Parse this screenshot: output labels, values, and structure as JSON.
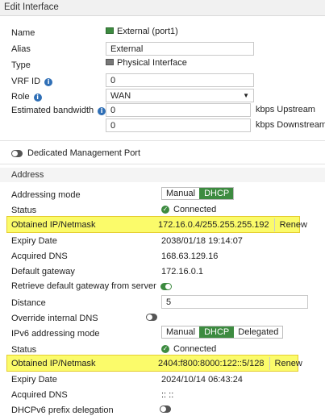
{
  "header": {
    "title": "Edit Interface"
  },
  "fields": {
    "name_label": "Name",
    "name_value": "External (port1)",
    "alias_label": "Alias",
    "alias_value": "External",
    "type_label": "Type",
    "type_value": "Physical Interface",
    "vrf_label": "VRF ID",
    "vrf_value": "0",
    "role_label": "Role",
    "role_value": "WAN",
    "bw_label": "Estimated bandwidth",
    "bw_up_value": "0",
    "bw_up_unit": "kbps Upstream",
    "bw_down_value": "0",
    "bw_down_unit": "kbps Downstream",
    "dedicated_mgmt_label": "Dedicated Management Port"
  },
  "address": {
    "section_title": "Address",
    "addressing_mode_label": "Addressing mode",
    "addressing_mode_options": [
      "Manual",
      "DHCP"
    ],
    "addressing_mode_selected": "DHCP",
    "status_label": "Status",
    "status_value": "Connected",
    "obtained_label": "Obtained IP/Netmask",
    "obtained_value": "172.16.0.4/255.255.255.192",
    "renew_label": "Renew",
    "expiry_label": "Expiry Date",
    "expiry_value": "2038/01/18 19:14:07",
    "dns_label": "Acquired DNS",
    "dns_value": "168.63.129.16",
    "gateway_label": "Default gateway",
    "gateway_value": "172.16.0.1",
    "retrieve_gw_label": "Retrieve default gateway from server",
    "retrieve_gw_enabled": true,
    "distance_label": "Distance",
    "distance_value": "5",
    "override_dns_label": "Override internal DNS",
    "override_dns_enabled": false
  },
  "ipv6": {
    "mode_label": "IPv6 addressing mode",
    "mode_options": [
      "Manual",
      "DHCP",
      "Delegated"
    ],
    "mode_selected": "DHCP",
    "status_label": "Status",
    "status_value": "Connected",
    "obtained_label": "Obtained IP/Netmask",
    "obtained_value": "2404:f800:8000:122::5/128",
    "renew_label": "Renew",
    "expiry_label": "Expiry Date",
    "expiry_value": "2024/10/14 06:43:24",
    "dns_label": "Acquired DNS",
    "dns_value": ":: ::",
    "prefix_label": "DHCPv6 prefix delegation",
    "prefix_enabled": false
  },
  "icons": {
    "info": "info-icon",
    "check": "check-circle-icon",
    "interface": "interface-port-icon",
    "physical": "physical-interface-icon",
    "dropdown": "chevron-down-icon"
  },
  "colors": {
    "accent_green": "#3d8b40",
    "info_blue": "#2f6fb6",
    "highlight_yellow": "#fbfb6a"
  }
}
